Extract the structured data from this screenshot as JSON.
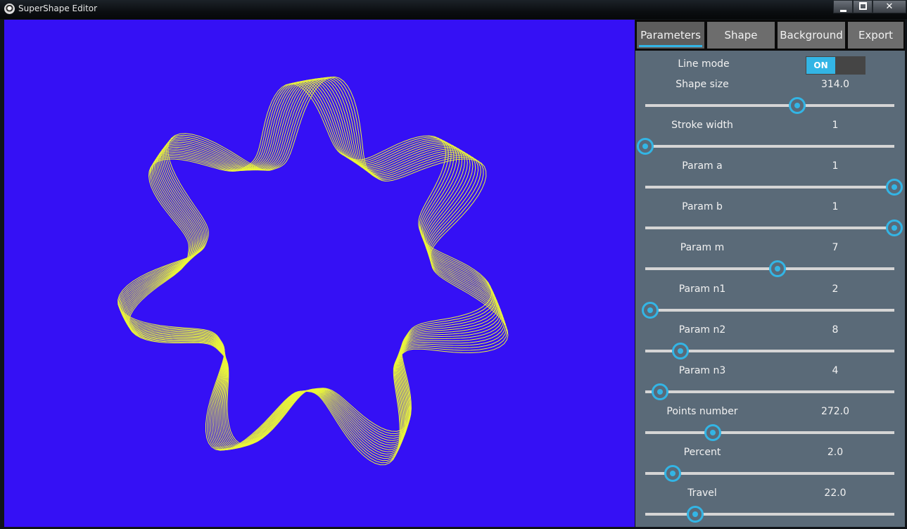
{
  "window": {
    "title": "SuperShape Editor"
  },
  "colors": {
    "canvas_bg": "#3510f5",
    "shape_stroke": "#eaf53a",
    "accent": "#33b5e5",
    "panel_bg": "#5a6a78"
  },
  "tabs": [
    {
      "label": "Parameters",
      "active": true
    },
    {
      "label": "Shape"
    },
    {
      "label": "Background"
    },
    {
      "label": "Export"
    }
  ],
  "line_mode": {
    "label": "Line mode",
    "state": "ON"
  },
  "sliders": [
    {
      "label": "Shape size",
      "value": "314.0",
      "fraction": 0.61
    },
    {
      "label": "Stroke width",
      "value": "1",
      "fraction": 0.0
    },
    {
      "label": "Param a",
      "value": "1",
      "fraction": 1.0
    },
    {
      "label": "Param b",
      "value": "1",
      "fraction": 1.0
    },
    {
      "label": "Param m",
      "value": "7",
      "fraction": 0.53
    },
    {
      "label": "Param n1",
      "value": "2",
      "fraction": 0.02
    },
    {
      "label": "Param n2",
      "value": "8",
      "fraction": 0.14
    },
    {
      "label": "Param n3",
      "value": "4",
      "fraction": 0.06
    },
    {
      "label": "Points number",
      "value": "272.0",
      "fraction": 0.27
    },
    {
      "label": "Percent",
      "value": "2.0",
      "fraction": 0.11
    },
    {
      "label": "Travel",
      "value": "22.0",
      "fraction": 0.2
    }
  ],
  "icons": {
    "app": "supershape-app-icon",
    "minimize": "minimize-icon",
    "maximize": "maximize-icon",
    "close": "close-icon"
  }
}
